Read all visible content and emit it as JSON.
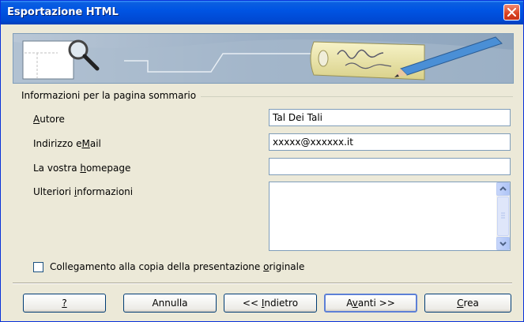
{
  "window": {
    "title": "Esportazione HTML"
  },
  "section": {
    "title": "Informazioni per la pagina sommario"
  },
  "fields": {
    "author": {
      "label_pre": "",
      "label_key": "A",
      "label_post": "utore",
      "value": "Tal Dei Tali"
    },
    "email": {
      "label_pre": "Indirizzo e",
      "label_key": "M",
      "label_post": "ail",
      "value": "xxxxx@xxxxxx.it"
    },
    "homepage": {
      "label_pre": "La vostra ",
      "label_key": "h",
      "label_post": "omepage",
      "value": ""
    },
    "info": {
      "label_pre": "Ulteriori ",
      "label_key": "i",
      "label_post": "nformazioni",
      "value": ""
    }
  },
  "checkbox": {
    "label_pre": "Collegamento alla copia della presentazione ",
    "label_key": "o",
    "label_post": "riginale",
    "checked": false
  },
  "buttons": {
    "help": {
      "label": "?"
    },
    "cancel": {
      "label": "Annulla"
    },
    "back": {
      "pre": "<< ",
      "key": "I",
      "post": "ndietro"
    },
    "next": {
      "pre": "A",
      "key": "v",
      "post": "anti >>"
    },
    "create": {
      "pre": "",
      "key": "C",
      "post": "rea"
    }
  },
  "icons": {
    "close": "close-icon",
    "scroll_up": "arrow-up-icon",
    "scroll_down": "arrow-down-icon",
    "banner": "magnifier-pencil-illustration"
  },
  "colors": {
    "title_bar": "#0054e3",
    "dialog_bg": "#ece9d8",
    "input_border": "#7f9db9"
  }
}
